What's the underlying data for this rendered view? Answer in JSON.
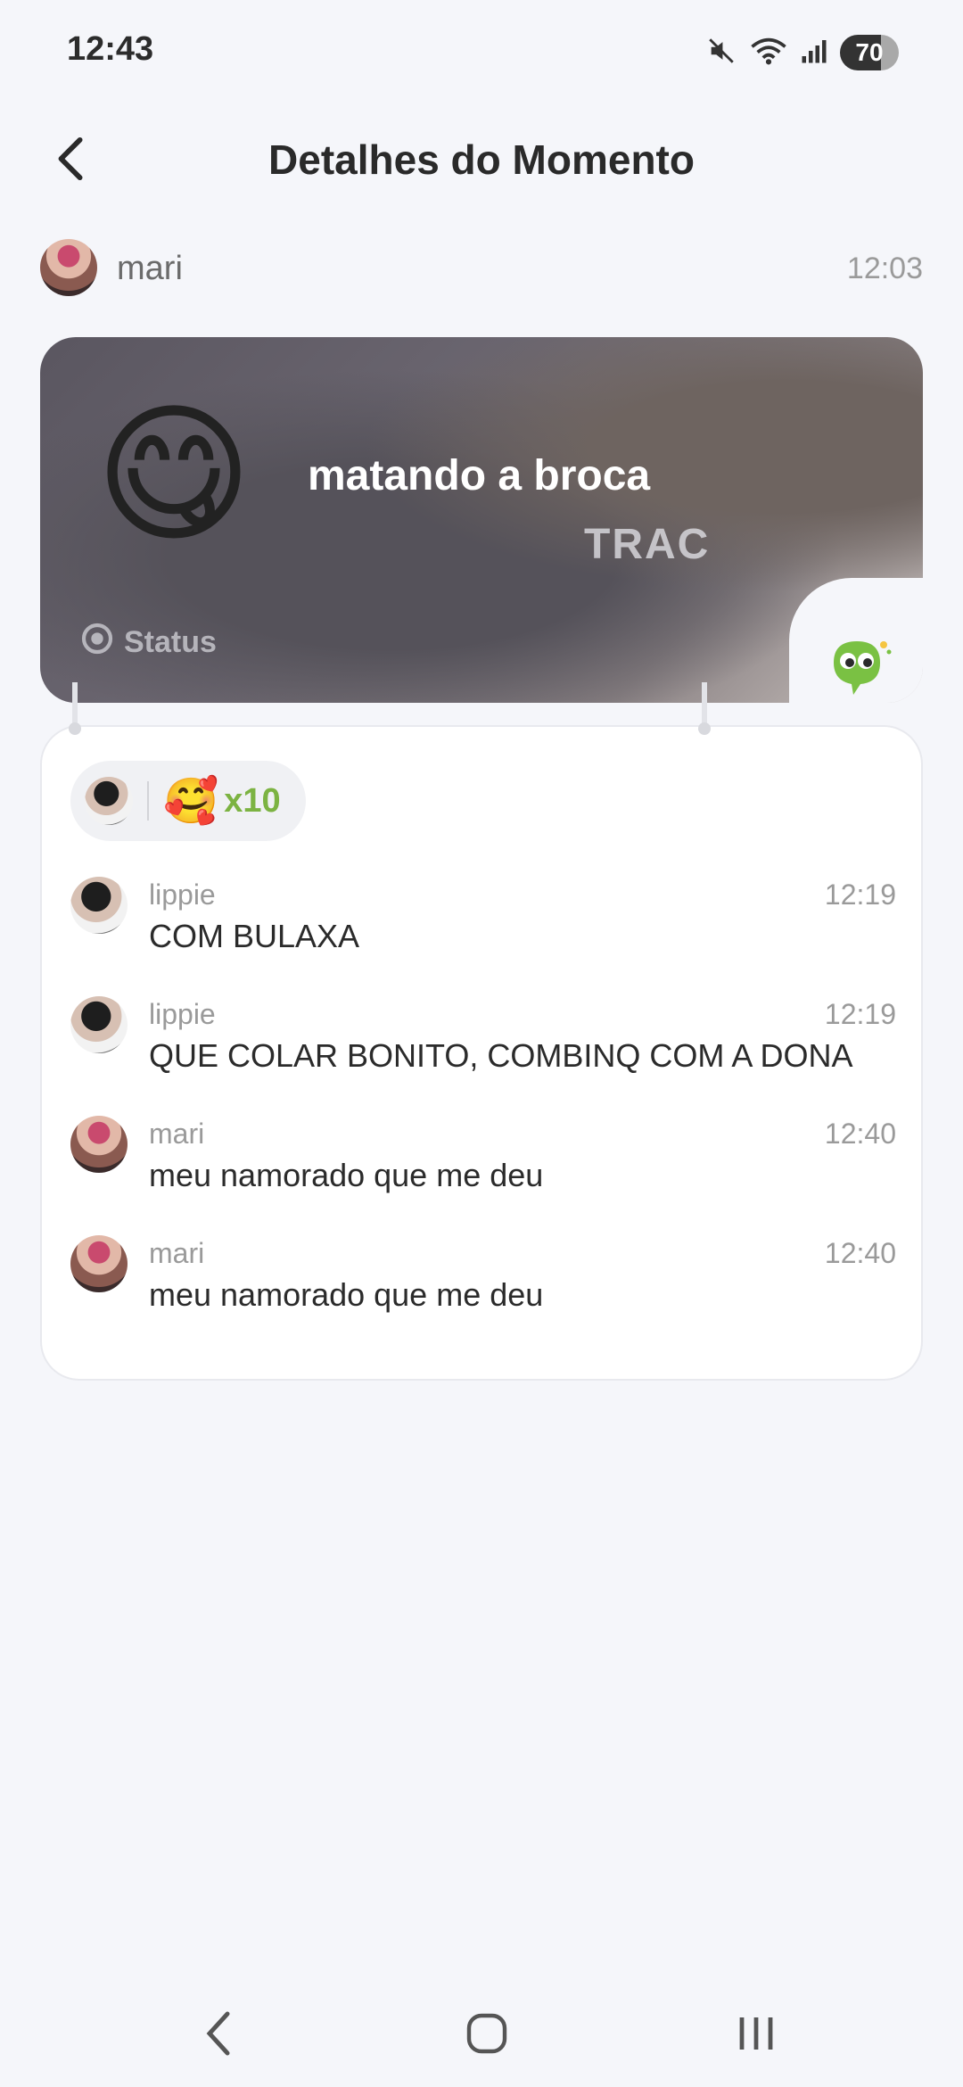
{
  "status_bar": {
    "time": "12:43",
    "battery": "70",
    "icons": [
      "mute-icon",
      "wifi-icon",
      "signal-icon",
      "battery-icon"
    ]
  },
  "header": {
    "title": "Detalhes do Momento",
    "back_icon": "back-arrow-icon"
  },
  "author": {
    "name": "mari",
    "time": "12:03"
  },
  "moment": {
    "emoji": "😋",
    "text": "matando a broca",
    "photo_text": "TRAC",
    "status_label": "Status"
  },
  "reactions": {
    "emoji": "🥰",
    "count": "x10"
  },
  "comments": [
    {
      "user": "lippie",
      "time": "12:19",
      "text": "COM BULAXA"
    },
    {
      "user": "lippie",
      "time": "12:19",
      "text": "QUE COLAR BONITO, COMBINQ COM A DONA"
    },
    {
      "user": "mari",
      "time": "12:40",
      "text": "meu namorado que me deu"
    },
    {
      "user": "mari",
      "time": "12:40",
      "text": "meu namorado que me deu"
    }
  ],
  "colors": {
    "background": "#f5f6fa",
    "accent_green": "#7cb342",
    "text_primary": "#2b2b2b",
    "text_secondary": "#9a9a9a"
  }
}
